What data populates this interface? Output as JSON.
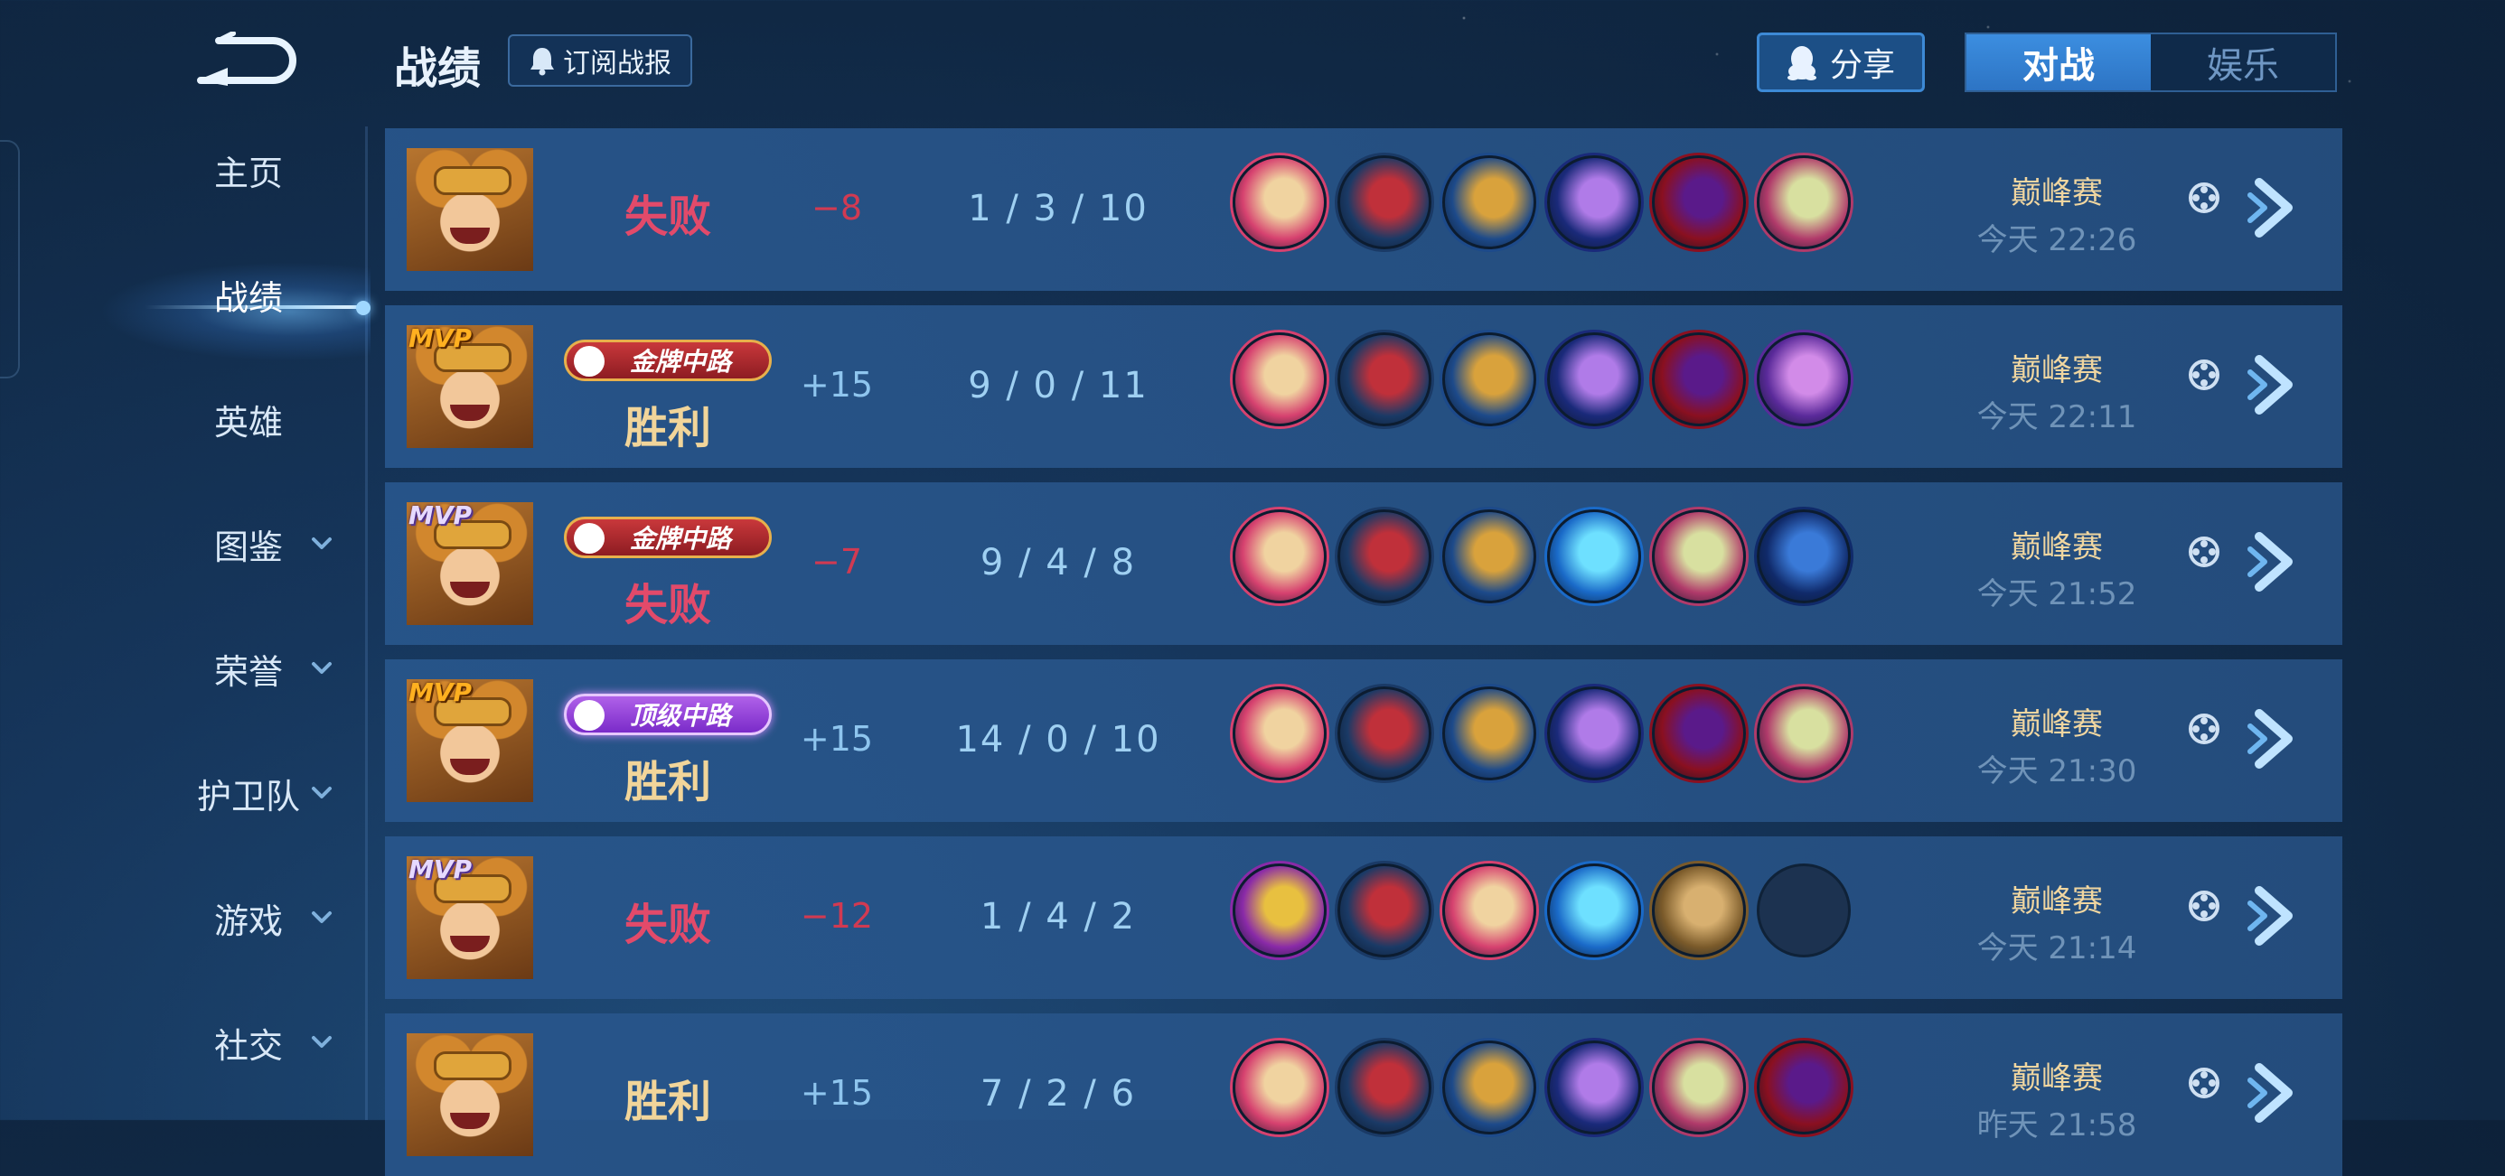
{
  "header": {
    "title": "战绩",
    "subscribe_label": "订阅战报",
    "share_label": "分享",
    "mode_tabs": [
      {
        "label": "对战",
        "active": true
      },
      {
        "label": "娱乐",
        "active": false
      }
    ]
  },
  "nav": {
    "items": [
      {
        "label": "主页",
        "dropdown": false,
        "active": false
      },
      {
        "label": "战绩",
        "dropdown": false,
        "active": true
      },
      {
        "label": "英雄",
        "dropdown": false,
        "active": false
      },
      {
        "label": "图鉴",
        "dropdown": true,
        "active": false
      },
      {
        "label": "荣誉",
        "dropdown": true,
        "active": false
      },
      {
        "label": "护卫队",
        "dropdown": true,
        "active": false
      },
      {
        "label": "游戏",
        "dropdown": true,
        "active": false
      },
      {
        "label": "社交",
        "dropdown": true,
        "active": false
      }
    ]
  },
  "icons": {
    "back": "back-arrow-icon",
    "subscribe": "bell-icon",
    "share": "penguin-icon",
    "nav_dropdown": "chevron-down-icon",
    "replay": "film-reel-icon",
    "detail": "chevron-right-icon"
  },
  "colors": {
    "lose": "#e24a6a",
    "win": "#f1d59a",
    "score_negative": "#d13a52",
    "score_positive": "#8ec5ee",
    "accent": "#3c8ee0"
  },
  "matches": [
    {
      "mvp": "",
      "badge": "",
      "result": "失败",
      "outcome": "lose",
      "score": "−8",
      "score_sign": "neg",
      "kda": "1 / 3 / 10",
      "mode": "巅峰赛",
      "time": "今天 22:26",
      "items": [
        "#d6416f,#f0d3a0",
        "#1a3a66,#c0303a",
        "#1d4a8a,#d9a23c",
        "#1a2a7a,#b07be8",
        "#8a1020,#5a1a8a",
        "#b03a6a,#d8e0a0"
      ]
    },
    {
      "mvp": "gold",
      "badge": "金牌中路",
      "badge_style": "gold",
      "result": "胜利",
      "outcome": "win",
      "score": "+15",
      "score_sign": "pos",
      "kda": "9 / 0 / 11",
      "mode": "巅峰赛",
      "time": "今天 22:11",
      "items": [
        "#d6416f,#f0d3a0",
        "#1a3a66,#c0303a",
        "#1d4a8a,#d9a23c",
        "#1a2a7a,#b07be8",
        "#8a1020,#5a1a8a",
        "#5a2a9a,#d28be8"
      ]
    },
    {
      "mvp": "silver",
      "badge": "金牌中路",
      "badge_style": "gold",
      "result": "失败",
      "outcome": "lose",
      "score": "−7",
      "score_sign": "neg",
      "kda": "9 / 4 / 8",
      "mode": "巅峰赛",
      "time": "今天 21:52",
      "items": [
        "#d6416f,#f0d3a0",
        "#1a3a66,#c0303a",
        "#1d4a8a,#d9a23c",
        "#1a6ac8,#6ee0ff",
        "#b03a6a,#d8e0a0",
        "#102a6a,#3a7ad8"
      ]
    },
    {
      "mvp": "gold",
      "badge": "顶级中路",
      "badge_style": "purple",
      "result": "胜利",
      "outcome": "win",
      "score": "+15",
      "score_sign": "pos",
      "kda": "14 / 0 / 10",
      "mode": "巅峰赛",
      "time": "今天 21:30",
      "items": [
        "#d6416f,#f0d3a0",
        "#1a3a66,#c0303a",
        "#1d4a8a,#d9a23c",
        "#1a2a7a,#b07be8",
        "#8a1020,#5a1a8a",
        "#b03a6a,#d8e0a0"
      ]
    },
    {
      "mvp": "silver",
      "badge": "",
      "result": "失败",
      "outcome": "lose",
      "score": "−12",
      "score_sign": "neg",
      "kda": "1 / 4 / 2",
      "mode": "巅峰赛",
      "time": "今天 21:14",
      "items": [
        "#8a2aa8,#e8c040",
        "#1a3a66,#c0303a",
        "#d6416f,#f0d3a0",
        "#1a6ac8,#6ee0ff",
        "#7a5a2a,#d8b070",
        ""
      ]
    },
    {
      "mvp": "",
      "badge": "",
      "result": "胜利",
      "outcome": "win",
      "score": "+15",
      "score_sign": "pos",
      "kda": "7 / 2 / 6",
      "mode": "巅峰赛",
      "time": "昨天 21:58",
      "items": [
        "#d6416f,#f0d3a0",
        "#1a3a66,#c0303a",
        "#1d4a8a,#d9a23c",
        "#1a2a7a,#b07be8",
        "#b03a6a,#d8e0a0",
        "#8a1020,#5a1a8a"
      ]
    }
  ]
}
